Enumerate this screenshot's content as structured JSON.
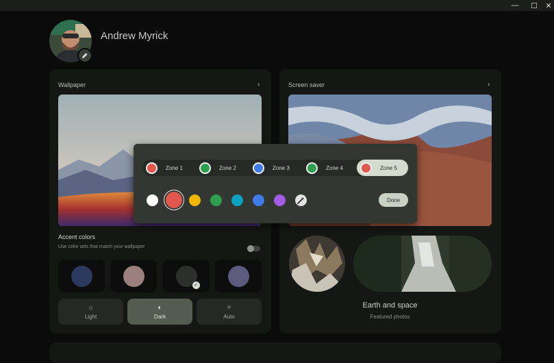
{
  "window": {
    "controls": {
      "minimize": "—",
      "maximize": "☐",
      "close": "✕"
    }
  },
  "profile": {
    "name": "Andrew Myrick"
  },
  "wallpaper": {
    "title": "Wallpaper"
  },
  "screensaver": {
    "title": "Screen saver",
    "album_title": "Earth and space",
    "album_subtitle": "Featured photos"
  },
  "accent": {
    "title": "Accent colors",
    "subtitle": "Use color sets that match your wallpaper",
    "match_toggle_on": false,
    "swatches": [
      {
        "color": "#2b3a5c",
        "selected": false
      },
      {
        "color": "#9a7f7c",
        "selected": false
      },
      {
        "color": "#2c2f2c",
        "selected": true
      },
      {
        "color": "#5d5a7d",
        "selected": false
      }
    ]
  },
  "theme": {
    "modes": [
      {
        "label": "Light",
        "icon": "light-mode-icon",
        "active": false
      },
      {
        "label": "Dark",
        "icon": "dark-mode-icon",
        "active": true
      },
      {
        "label": "Auto",
        "icon": "auto-mode-icon",
        "active": false
      }
    ]
  },
  "keyboard_popup": {
    "zones": [
      {
        "label": "Zone 1",
        "color": "#e0584e",
        "active": false
      },
      {
        "label": "Zone 2",
        "color": "#2e9e4f",
        "active": false
      },
      {
        "label": "Zone 3",
        "color": "#3d7be6",
        "active": false
      },
      {
        "label": "Zone 4",
        "color": "#2e9e4f",
        "active": false
      },
      {
        "label": "Zone 5",
        "color": "#e0584e",
        "active": true
      }
    ],
    "palette": [
      {
        "color": "#ffffff",
        "selected": false
      },
      {
        "color": "#e0584e",
        "selected": true
      },
      {
        "color": "#f2b705",
        "selected": false
      },
      {
        "color": "#2e9e4f",
        "selected": false
      },
      {
        "color": "#0aa2c0",
        "selected": false
      },
      {
        "color": "#3d7be6",
        "selected": false
      },
      {
        "color": "#a35ce6",
        "selected": false
      }
    ],
    "custom_icon": "magic-wand-icon",
    "done_label": "Done"
  }
}
